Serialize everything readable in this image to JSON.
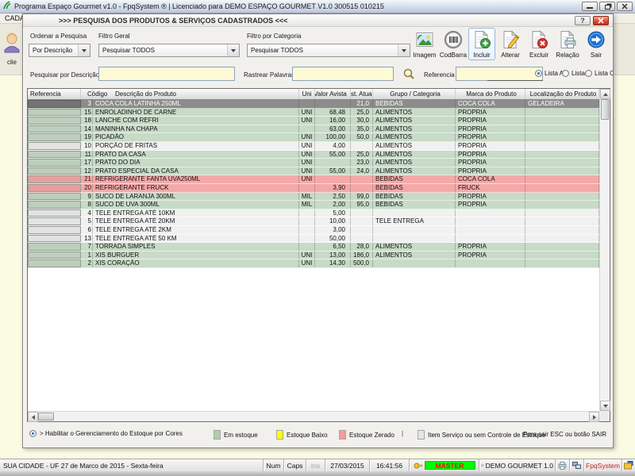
{
  "window": {
    "title": "Programa Espaço Gourmet v1.0 - FpqSystem ® | Licenciado para  DEMO ESPAÇO GOURMET V1.0 300515 010215",
    "menu_item": "CADA",
    "toolbar_item": "clie"
  },
  "dialog": {
    "title": ">>>  PESQUISA DOS PRODUTOS & SERVIÇOS CADASTRADOS  <<<",
    "help_label": "?",
    "filters": {
      "order_label": "Ordenar a Pesquisa",
      "order_value": "Por Descrição",
      "general_label": "Filtro Geral",
      "general_value": "Pesquisar TODOS",
      "category_label": "Filtro por Categoria",
      "category_value": "Pesquisar TODOS"
    },
    "toolbar": [
      {
        "icon": "image-icon",
        "label": "Imagem"
      },
      {
        "icon": "barcode-icon",
        "label": "CodBarra"
      },
      {
        "icon": "add-doc-icon",
        "label": "Incluir",
        "highlighted": true
      },
      {
        "icon": "edit-doc-icon",
        "label": "Alterar"
      },
      {
        "icon": "delete-doc-icon",
        "label": "Excluir"
      },
      {
        "icon": "report-icon",
        "label": "Relação"
      },
      {
        "icon": "exit-icon",
        "label": "Sair"
      }
    ],
    "search": {
      "description_label": "Pesquisar por Descrição",
      "description_value": "",
      "words_label": "Rastrear Palavras",
      "words_value": "",
      "reference_label": "Referencia",
      "reference_value": "",
      "list_options": [
        "Lista A",
        "Lista B",
        "Lista C"
      ],
      "selected_list": "Lista A"
    },
    "table": {
      "columns": [
        "Referencia",
        "Código",
        "Descrição do Produto",
        "Uni",
        "Valor Avista",
        "Est. Atual",
        "Grupo / Categoria",
        "Marca do Produto",
        "Localização do Produto"
      ],
      "rows": [
        {
          "referencia": "",
          "codigo": "3",
          "descricao": "COCA COLA LATINHA 250ML",
          "uni": "",
          "valor": "",
          "est": "21,0",
          "grupo": "BEBIDAS",
          "marca": "COCA COLA",
          "local": "GELADEIRA",
          "state": "selected"
        },
        {
          "referencia": "",
          "codigo": "15",
          "descricao": "ENROLADINHO DE CARNE",
          "uni": "UNI",
          "valor": "68,48",
          "est": "25,0",
          "grupo": "ALIMENTOS",
          "marca": "PROPRIA",
          "local": "",
          "state": "green"
        },
        {
          "referencia": "",
          "codigo": "18",
          "descricao": "LANCHE COM REFRI",
          "uni": "UNI",
          "valor": "16,00",
          "est": "30,0",
          "grupo": "ALIMENTOS",
          "marca": "PROPRIA",
          "local": "",
          "state": "green"
        },
        {
          "referencia": "",
          "codigo": "14",
          "descricao": "MANINHA NA CHAPA",
          "uni": "",
          "valor": "63,00",
          "est": "35,0",
          "grupo": "ALIMENTOS",
          "marca": "PROPRIA",
          "local": "",
          "state": "green"
        },
        {
          "referencia": "",
          "codigo": "19",
          "descricao": "PICADÃO",
          "uni": "UNI",
          "valor": "100,00",
          "est": "50,0",
          "grupo": "ALIMENTOS",
          "marca": "PROPRIA",
          "local": "",
          "state": "green"
        },
        {
          "referencia": "",
          "codigo": "10",
          "descricao": "PORÇÃO DE FRITAS",
          "uni": "UNI",
          "valor": "4,00",
          "est": "",
          "grupo": "ALIMENTOS",
          "marca": "PROPRIA",
          "local": "",
          "state": "service"
        },
        {
          "referencia": "",
          "codigo": "11",
          "descricao": "PRATO DA CASA",
          "uni": "UNI",
          "valor": "55,00",
          "est": "25,0",
          "grupo": "ALIMENTOS",
          "marca": "PROPRIA",
          "local": "",
          "state": "green"
        },
        {
          "referencia": "",
          "codigo": "17",
          "descricao": "PRATO DO DIA",
          "uni": "UNI",
          "valor": "",
          "est": "23,0",
          "grupo": "ALIMENTOS",
          "marca": "PROPRIA",
          "local": "",
          "state": "green"
        },
        {
          "referencia": "",
          "codigo": "12",
          "descricao": "PRATO ESPECIAL DA CASA",
          "uni": "UNI",
          "valor": "55,00",
          "est": "24,0",
          "grupo": "ALIMENTOS",
          "marca": "PROPRIA",
          "local": "",
          "state": "green"
        },
        {
          "referencia": "",
          "codigo": "21",
          "descricao": "REFRIGERANTE FANTA UVA250ML",
          "uni": "UNI",
          "valor": "",
          "est": "",
          "grupo": "BEBIDAS",
          "marca": "COCA COLA",
          "local": "",
          "state": "zero"
        },
        {
          "referencia": "",
          "codigo": "20",
          "descricao": "REFRIGERANTE FRUCK",
          "uni": "",
          "valor": "3,90",
          "est": "",
          "grupo": "BEBIDAS",
          "marca": "FRUCK",
          "local": "",
          "state": "zero"
        },
        {
          "referencia": "",
          "codigo": "9",
          "descricao": "SUCO DE LARANJA 300ML",
          "uni": "MIL",
          "valor": "2,50",
          "est": "99,0",
          "grupo": "BEBIDAS",
          "marca": "PROPRIA",
          "local": "",
          "state": "green"
        },
        {
          "referencia": "",
          "codigo": "8",
          "descricao": "SUCO DE UVA 300ML",
          "uni": "MIL",
          "valor": "2,00",
          "est": "95,0",
          "grupo": "BEBIDAS",
          "marca": "PROPRIA",
          "local": "",
          "state": "green"
        },
        {
          "referencia": "",
          "codigo": "4",
          "descricao": "TELE ENTREGA ATÉ 10KM",
          "uni": "",
          "valor": "5,00",
          "est": "",
          "grupo": "",
          "marca": "",
          "local": "",
          "state": "service"
        },
        {
          "referencia": "",
          "codigo": "5",
          "descricao": "TELE ENTREGA ATÉ 20KM",
          "uni": "",
          "valor": "10,00",
          "est": "",
          "grupo": "TELE ENTREGA",
          "marca": "",
          "local": "",
          "state": "service"
        },
        {
          "referencia": "",
          "codigo": "6",
          "descricao": "TELE ENTREGA ATÉ 2KM",
          "uni": "",
          "valor": "3,00",
          "est": "",
          "grupo": "",
          "marca": "",
          "local": "",
          "state": "service"
        },
        {
          "referencia": "",
          "codigo": "13",
          "descricao": "TELE ENTREGA ATÉ 50 KM",
          "uni": "",
          "valor": "50,00",
          "est": "",
          "grupo": "",
          "marca": "",
          "local": "",
          "state": "service"
        },
        {
          "referencia": "",
          "codigo": "7",
          "descricao": "TORRADA SIMPLES",
          "uni": "",
          "valor": "6,50",
          "est": "28,0",
          "grupo": "ALIMENTOS",
          "marca": "PROPRIA",
          "local": "",
          "state": "green"
        },
        {
          "referencia": "",
          "codigo": "1",
          "descricao": "XIS BURGUER",
          "uni": "UNI",
          "valor": "13,00",
          "est": "186,0",
          "grupo": "ALIMENTOS",
          "marca": "PROPRIA",
          "local": "",
          "state": "green"
        },
        {
          "referencia": "",
          "codigo": "2",
          "descricao": "XIS CORAÇÃO",
          "uni": "UNI",
          "valor": "14,30",
          "est": "500,0",
          "grupo": "",
          "marca": "",
          "local": "",
          "state": "green"
        }
      ]
    },
    "legend": {
      "toggle_label": "> Habilitar o Gerenciamento do Estoque por Cores",
      "items": [
        {
          "label": "Em estoque",
          "color": "#aecfae"
        },
        {
          "label": "Estoque Baixo",
          "color": "#ffff00"
        },
        {
          "label": "Estoque Zerado",
          "color": "#f49c9c"
        },
        {
          "label": "Item Serviço ou sem Controle de Estoque",
          "color": "#e6e6e6"
        }
      ],
      "separator": "|",
      "exit_hint": "Para sair ESC ou botão SAIR"
    }
  },
  "statusbar": {
    "location": "SUA CIDADE - UF 27 de Marco de 2015 - Sexta-feira",
    "num": "Num",
    "caps": "Caps",
    "ins": "Ins",
    "date": "27/03/2015",
    "time": "16:41:56",
    "user": "MASTER",
    "user_bg": "#00ff00",
    "user_color": "#ff0000",
    "company": "DEMO GOURMET 1.0",
    "brand": "FpqSystem",
    "brand_color": "#cc2222"
  }
}
